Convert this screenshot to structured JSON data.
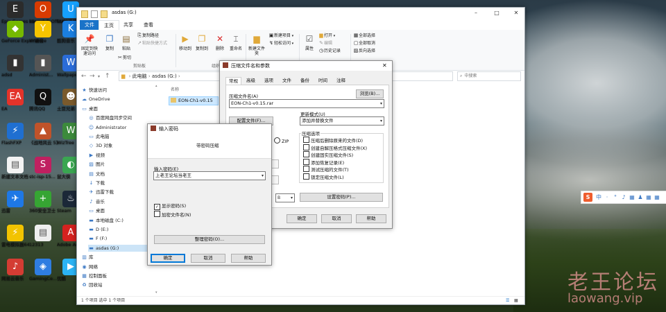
{
  "desktop": {
    "icons": [
      {
        "label": "Epic Games Launcher",
        "glyph": "E",
        "color": "#2b2b2b"
      },
      {
        "label": "Microsoft Office",
        "glyph": "O",
        "color": "#d83b01"
      },
      {
        "label": "新建文本文档 (4)",
        "glyph": "▤",
        "color": "#f3f3f3"
      },
      {
        "label": "UU加速器",
        "glyph": "U",
        "color": "#16a1ff"
      },
      {
        "label": "GeForce Experience",
        "glyph": "◆",
        "color": "#76b900"
      },
      {
        "label": "YY语音",
        "glyph": "Y",
        "color": "#f6c400"
      },
      {
        "label": "酷狗音乐",
        "glyph": "K",
        "color": "#1b7fe0"
      },
      {
        "label": "adsd",
        "glyph": "▮",
        "color": "#333333"
      },
      {
        "label": "Administ...",
        "glyph": "▮",
        "color": "#555555"
      },
      {
        "label": "Wallpaper Engine",
        "glyph": "W",
        "color": "#2a6cd8"
      },
      {
        "label": "EA",
        "glyph": "EA",
        "color": "#e3332a"
      },
      {
        "label": "腾讯QQ",
        "glyph": "Q",
        "color": "#111111"
      },
      {
        "label": "土豆兄弟 (Brotato)",
        "glyph": "☻",
        "color": "#7a5a2c"
      },
      {
        "label": "FlashFXP",
        "glyph": "⚡",
        "color": "#1f6fd1"
      },
      {
        "label": "《战地风云 5》",
        "glyph": "▲",
        "color": "#c0532a"
      },
      {
        "label": "WizTree",
        "glyph": "W",
        "color": "#3c8a3c"
      },
      {
        "label": "新建文本文档",
        "glyph": "▤",
        "color": "#f3f3f3"
      },
      {
        "label": "stc-isp-15...",
        "glyph": "S",
        "color": "#c02060"
      },
      {
        "label": "鼠大侠",
        "glyph": "◐",
        "color": "#3aa651"
      },
      {
        "label": "迅雷",
        "glyph": "✈",
        "color": "#1e78e6"
      },
      {
        "label": "360安全卫士",
        "glyph": "+",
        "color": "#36a533"
      },
      {
        "label": "Steam",
        "glyph": "♨",
        "color": "#1b2838"
      },
      {
        "label": "雷电模拟器64",
        "glyph": "⚡",
        "color": "#f2c300"
      },
      {
        "label": "12313",
        "glyph": "▤",
        "color": "#eeeeee"
      },
      {
        "label": "Adobe Acrobat",
        "glyph": "A",
        "color": "#d4221f"
      },
      {
        "label": "网易云音乐",
        "glyph": "♪",
        "color": "#d43c33"
      },
      {
        "label": "GamingCe...",
        "glyph": "◈",
        "color": "#2f7de1"
      },
      {
        "label": "优酷",
        "glyph": "▶",
        "color": "#2bb4f5"
      }
    ]
  },
  "explorer": {
    "title": "asdas (G:)",
    "tabs": [
      "文件",
      "主页",
      "共享",
      "查看"
    ],
    "ribbon": {
      "pin_quick_access": "固定到快速访问",
      "copy": "复制",
      "paste": "粘贴",
      "copy_path": "复制路径",
      "paste_shortcut": "粘贴快捷方式",
      "cut": "剪切",
      "clipboard_group": "剪贴板",
      "move_to": "移动到",
      "copy_to": "复制到",
      "delete": "删除",
      "rename": "重命名",
      "organize_group": "组织",
      "new_item": "新建项目",
      "easy_access": "轻松访问",
      "new_folder": "新建文件夹",
      "new_group": "新建",
      "properties": "属性",
      "open": "打开",
      "edit": "编辑",
      "history": "历史记录",
      "open_group": "打开",
      "select_all": "全部选择",
      "select_none": "全部取消",
      "invert_select": "反向选择",
      "select_group": "选择"
    },
    "address": {
      "crumb1": "此电脑",
      "crumb2": "asdas (G:)"
    },
    "search_placeholder": "中搜索",
    "nav": [
      {
        "label": "快速访问",
        "icon": "★"
      },
      {
        "label": "OneDrive",
        "icon": "☁"
      },
      {
        "label": "桌面",
        "icon": "▭"
      },
      {
        "label": "百度网盘同步空间",
        "icon": "◎"
      },
      {
        "label": "Administrator",
        "icon": "☺"
      },
      {
        "label": "此电脑",
        "icon": "▭"
      },
      {
        "label": "3D 对象",
        "icon": "◇"
      },
      {
        "label": "视频",
        "icon": "▶"
      },
      {
        "label": "图片",
        "icon": "▨"
      },
      {
        "label": "文档",
        "icon": "▤"
      },
      {
        "label": "下载",
        "icon": "↓"
      },
      {
        "label": "迅雷下载",
        "icon": "✈"
      },
      {
        "label": "音乐",
        "icon": "♪"
      },
      {
        "label": "桌面",
        "icon": "▭"
      },
      {
        "label": "本地磁盘 (C:)",
        "icon": "▬"
      },
      {
        "label": "D (E:)",
        "icon": "▬"
      },
      {
        "label": "F (F:)",
        "icon": "▬"
      },
      {
        "label": "asdas (G:)",
        "icon": "▬"
      },
      {
        "label": "库",
        "icon": "▥"
      },
      {
        "label": "网络",
        "icon": "◉"
      },
      {
        "label": "控制面板",
        "icon": "▦"
      },
      {
        "label": "回收站",
        "icon": "♻"
      }
    ],
    "column_name": "名称",
    "file_name": "EON-Ch1-v0.15",
    "status": "1 个项目   选中 1 个项目"
  },
  "rar_dialog": {
    "title": "压缩文件名和参数",
    "tabs": [
      "常规",
      "高级",
      "选项",
      "文件",
      "备份",
      "时间",
      "注释"
    ],
    "archive_name_label": "压缩文件名(A)",
    "browse_button": "浏览(B)...",
    "archive_name_value": "EON-Ch1-v0.15.rar",
    "profile_button": "配置文件(F)...",
    "update_mode_label": "更新模式(U)",
    "update_mode_value": "添加并替换文件",
    "format_zip": "ZIP",
    "options_label": "压缩选项",
    "options": [
      "压缩后删除原来的文件(D)",
      "创建自解压格式压缩文件(X)",
      "创建固实压缩文件(S)",
      "添加恢复记录(E)",
      "测试压缩的文件(T)",
      "锁定压缩文件(L)"
    ],
    "set_password_button": "设置密码(P)...",
    "ok_button": "确定",
    "cancel_button": "取消",
    "help_button": "帮助"
  },
  "password_dialog": {
    "title": "输入密码",
    "heading": "带密码压缩",
    "password_label": "输入密码(E)",
    "password_value": "上老王论坛当老王",
    "show_password": "显示密码(S)",
    "encrypt_filenames": "加密文件名(N)",
    "organize_button": "整理密码(O)...",
    "ok_button": "确定",
    "cancel_button": "取消",
    "help_button": "帮助"
  },
  "ime_bar": {
    "glyph": "S",
    "items": [
      "中",
      "·",
      "°",
      "♪",
      "▦",
      "♟",
      "▦",
      "▦"
    ]
  },
  "watermark": {
    "cn": "老王论坛",
    "en": "laowang.vip"
  }
}
